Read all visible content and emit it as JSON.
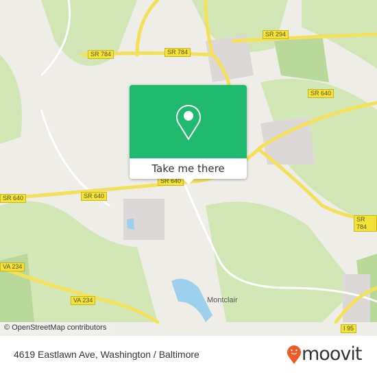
{
  "map": {
    "road_labels": [
      "SR 784",
      "SR 784",
      "SR 294",
      "SR 640",
      "SR 640",
      "SR 640",
      "SR 640",
      "SR 784",
      "VA 234",
      "VA 234",
      "I 95"
    ],
    "place_labels": [
      "Montclair"
    ],
    "attribution": "© OpenStreetMap contributors"
  },
  "popup": {
    "button_label": "Take me there",
    "icon": "map-pin-icon",
    "color": "#1fba6d"
  },
  "footer": {
    "address": "4619 Eastlawn Ave, Washington / Baltimore",
    "brand": "moovit",
    "brand_color": "#f05a28"
  }
}
